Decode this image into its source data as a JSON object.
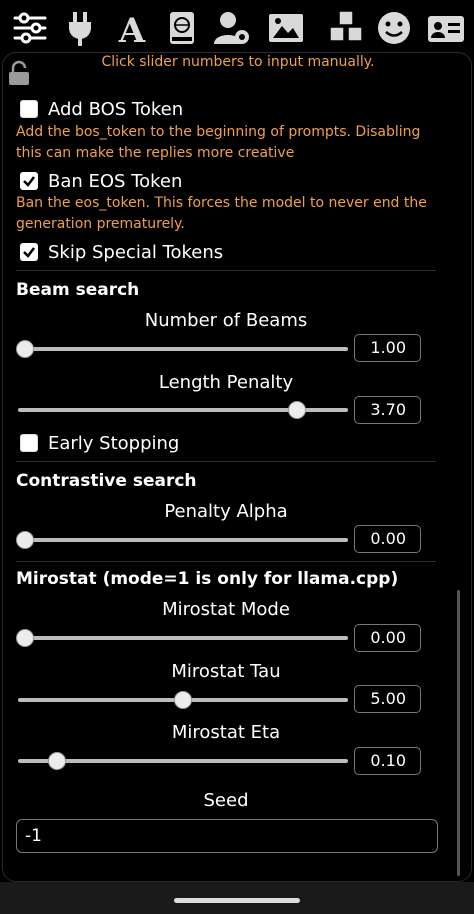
{
  "toolbar": {
    "icons": [
      "sliders-icon",
      "plug-icon",
      "font-icon",
      "book-globe-icon",
      "user-gear-icon",
      "image-icon",
      "cubes-icon",
      "smiley-icon",
      "id-card-icon"
    ]
  },
  "hint": "Click slider numbers to input manually.",
  "checkboxes": {
    "add_bos": {
      "label": "Add BOS Token",
      "checked": false,
      "desc": "Add the bos_token to the beginning of prompts. Disabling this can make the replies more creative"
    },
    "ban_eos": {
      "label": "Ban EOS Token",
      "checked": true,
      "desc": "Ban the eos_token. This forces the model to never end the generation prematurely."
    },
    "skip_special": {
      "label": "Skip Special Tokens",
      "checked": true
    },
    "early_stopping": {
      "label": "Early Stopping",
      "checked": false
    }
  },
  "sections": {
    "beam": "Beam search",
    "contrastive": "Contrastive search",
    "mirostat": "Mirostat (mode=1 is only for llama.cpp)"
  },
  "sliders": {
    "num_beams": {
      "label": "Number of Beams",
      "value": "1.00",
      "fraction": 0.0
    },
    "length_penalty": {
      "label": "Length Penalty",
      "value": "3.70",
      "fraction": 0.86
    },
    "penalty_alpha": {
      "label": "Penalty Alpha",
      "value": "0.00",
      "fraction": 0.0
    },
    "mirostat_mode": {
      "label": "Mirostat Mode",
      "value": "0.00",
      "fraction": 0.0
    },
    "mirostat_tau": {
      "label": "Mirostat Tau",
      "value": "5.00",
      "fraction": 0.5
    },
    "mirostat_eta": {
      "label": "Mirostat Eta",
      "value": "0.10",
      "fraction": 0.1
    }
  },
  "seed": {
    "label": "Seed",
    "value": "-1"
  }
}
